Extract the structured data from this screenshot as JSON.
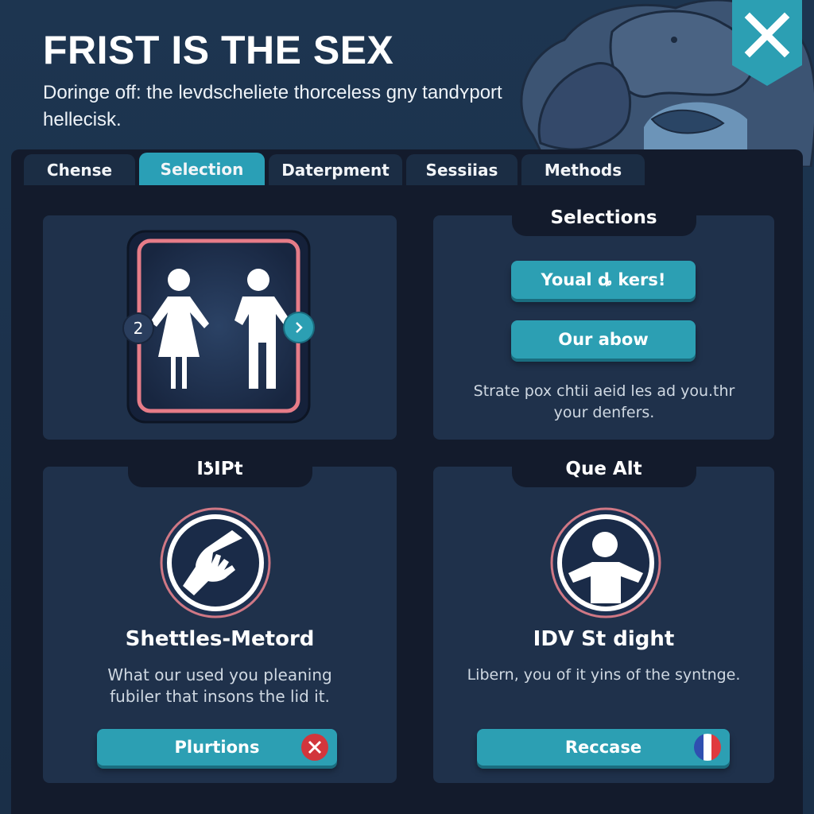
{
  "header": {
    "title": "FRIST IS THE SEX",
    "subtitle": "Doringe off: the levdscheliete thorceless gny tandʏport hellecisk.",
    "close_icon": "close-icon"
  },
  "tabs": [
    {
      "label": "Chense",
      "active": false
    },
    {
      "label": "Selection",
      "active": true
    },
    {
      "label": "Daterpment",
      "active": false
    },
    {
      "label": "Sessiias",
      "active": false
    },
    {
      "label": "Methods",
      "active": false
    }
  ],
  "cards": {
    "figure_card": {
      "icon": "man-woman-icon",
      "badge_left": "2",
      "badge_right_icon": "chevron-right-icon"
    },
    "selections": {
      "label": "Selections",
      "button_primary": "Youal ȡ kers!",
      "button_secondary": "Our abow",
      "description": "Strate pox chtii aeid les ad you.thr your denfers."
    },
    "left_bottom": {
      "label": "IƾIPt",
      "icon": "helping-hand-icon",
      "heading": "Shettles-Metord",
      "description": "What our used you pleaning fubiler that insons the lid it.",
      "button": "Plurtions",
      "button_icon": "close-circle-icon"
    },
    "right_bottom": {
      "label": "Que Alt",
      "icon": "person-icon",
      "heading": "IDV St dight",
      "description": "Libern, you of it yins of the syntnge.",
      "button": "Reccase",
      "button_icon": "french-flag-icon"
    }
  },
  "colors": {
    "accent": "#2c9fb3",
    "frame_pink": "#e67c88",
    "danger": "#d2363c",
    "flag_blue": "#2f4fb0",
    "flag_red": "#e03a3e"
  }
}
